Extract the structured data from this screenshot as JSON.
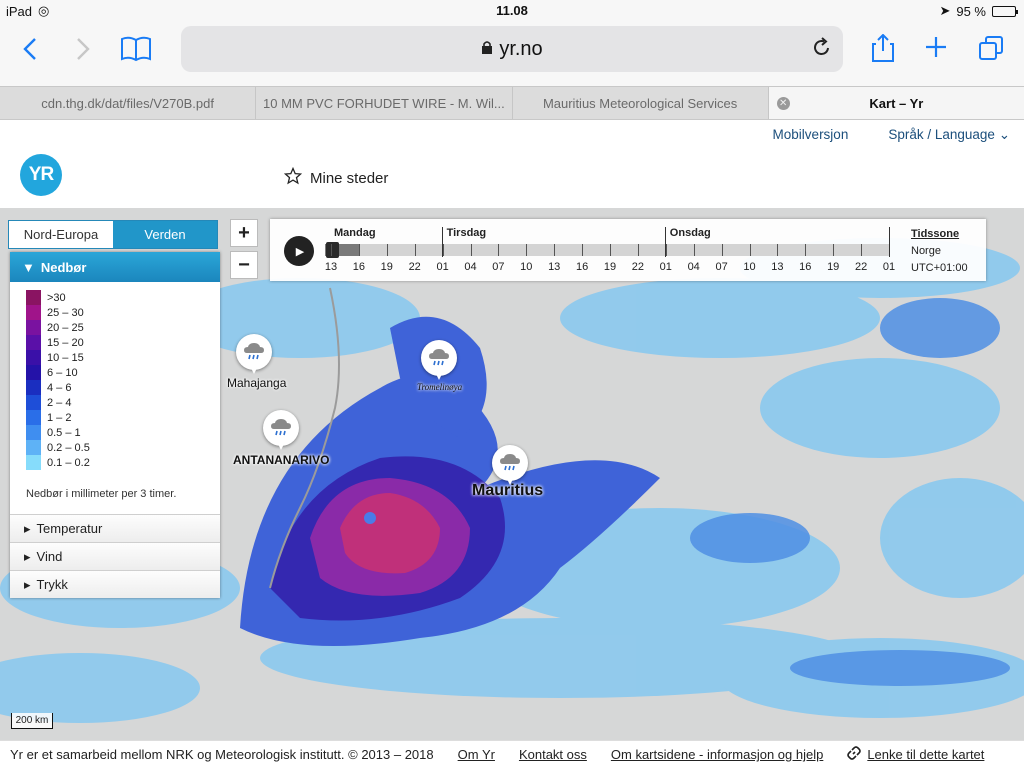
{
  "status": {
    "device": "iPad",
    "time": "11.08",
    "battery": "95 %"
  },
  "browser": {
    "url": "yr.no",
    "tabs": [
      {
        "title": "cdn.thg.dk/dat/files/V270B.pdf"
      },
      {
        "title": "10 MM PVC FORHUDET WIRE - M. Wil..."
      },
      {
        "title": "Mauritius Meteorological Services"
      },
      {
        "title": "Kart – Yr",
        "active": true
      }
    ]
  },
  "header": {
    "logo": "YR",
    "mobile": "Mobilversjon",
    "language": "Språk / Language",
    "my_places": "Mine steder"
  },
  "map": {
    "region_tabs": [
      "Nord-Europa",
      "Verden"
    ],
    "active_panel": "Nedbør",
    "legend": [
      {
        "label": ">30",
        "color": "#8a1462"
      },
      {
        "label": "25 – 30",
        "color": "#a0148a"
      },
      {
        "label": "20 – 25",
        "color": "#7a12a0"
      },
      {
        "label": "15 – 20",
        "color": "#5a10a8"
      },
      {
        "label": "10 – 15",
        "color": "#3a10a8"
      },
      {
        "label": "6 – 10",
        "color": "#2412a8"
      },
      {
        "label": "4 – 6",
        "color": "#1a2ec0"
      },
      {
        "label": "2 – 4",
        "color": "#1e4ed8"
      },
      {
        "label": "1 – 2",
        "color": "#2a6ee8"
      },
      {
        "label": "0.5 – 1",
        "color": "#3f8ef0"
      },
      {
        "label": "0.2 – 0.5",
        "color": "#5eb2f6"
      },
      {
        "label": "0.1 – 0.2",
        "color": "#86dcfb"
      }
    ],
    "legend_note": "Nedbør i millimeter per 3 timer.",
    "panels": [
      "Temperatur",
      "Vind",
      "Trykk"
    ],
    "zoom_in": "+",
    "zoom_out": "−",
    "scale": "200 km",
    "timeline": {
      "days": [
        "Mandag",
        "Tirsdag",
        "Onsdag"
      ],
      "hours": [
        "13",
        "16",
        "19",
        "22",
        "01",
        "04",
        "07",
        "10",
        "13",
        "16",
        "19",
        "22",
        "01",
        "04",
        "07",
        "10",
        "13",
        "16",
        "19",
        "22",
        "01"
      ],
      "timezone_title": "Tidssone",
      "timezone_name": "Norge",
      "timezone_offset": "UTC+01:00",
      "progress": 0.06
    },
    "places": [
      {
        "name": "Mahajanga",
        "icon": "rain-cloud-icon"
      },
      {
        "name": "Tromelinøya",
        "icon": "rain-cloud-icon"
      },
      {
        "name": "ANTANANARIVO",
        "icon": "rain-cloud-icon"
      },
      {
        "name": "Mauritius",
        "icon": "rain-cloud-icon"
      }
    ]
  },
  "footer": {
    "credit": "Yr er et samarbeid mellom NRK og Meteorologisk institutt. © 2013 – 2018",
    "links": [
      "Om Yr",
      "Kontakt oss",
      "Om kartsidene - informasjon og hjelp",
      "Lenke til dette kartet"
    ]
  },
  "colors": {
    "accent": "#1a7cf5",
    "yr_blue": "#22a6dd",
    "panel_head": "#1b86bd"
  }
}
